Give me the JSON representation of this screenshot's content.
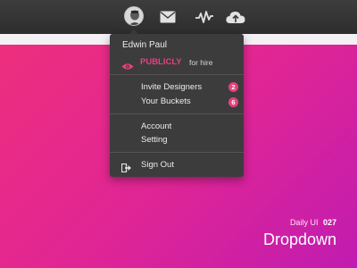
{
  "topbar": {
    "icons": [
      "avatar",
      "mail-icon",
      "activity-icon",
      "cloud-upload-icon"
    ]
  },
  "menu": {
    "user_name": "Edwin Paul",
    "visibility_status": "PUBLICLY",
    "visibility_suffix": "for hire",
    "items": [
      {
        "label": "Invite Designers",
        "badge": "2"
      },
      {
        "label": "Your Buckets",
        "badge": "6"
      }
    ],
    "account_label": "Account",
    "setting_label": "Setting",
    "sign_out_label": "Sign Out"
  },
  "caption": {
    "prefix": "Daily UI",
    "number": "027",
    "title": "Dropdown"
  },
  "colors": {
    "accent": "#e8407f",
    "menu_bg": "#3d3c3d",
    "topbar_bg": "#333233"
  }
}
